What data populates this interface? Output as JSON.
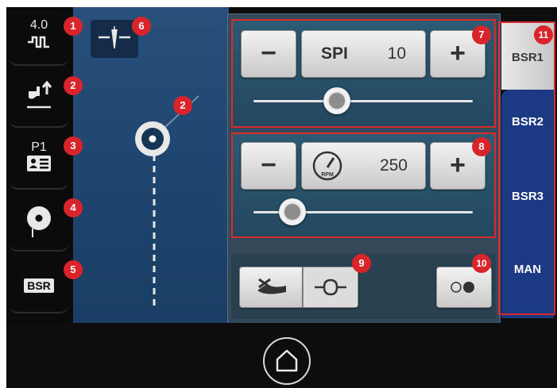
{
  "rail": {
    "r1": {
      "top": "4.0",
      "icon": "stitch-width-icon"
    },
    "r2": {
      "icon": "presser-foot-up-icon"
    },
    "r3": {
      "top": "P1",
      "icon": "program-icon"
    },
    "r4": {
      "icon": "bobbin-thread-icon"
    },
    "r5": {
      "label": "BSR"
    }
  },
  "controls": {
    "spi": {
      "minus": "−",
      "label": "SPI",
      "value": "10",
      "plus": "+",
      "slider_fraction": 0.38
    },
    "speed": {
      "minus": "−",
      "icon": "speedometer-icon",
      "icon_text": "RPM",
      "value": "250",
      "plus": "+",
      "slider_fraction": 0.17
    }
  },
  "tabs": {
    "t1": "BSR1",
    "t2": "BSR2",
    "t3": "BSR3",
    "t4": "MAN"
  },
  "badges": {
    "b1": "1",
    "b2": "2",
    "b3": "3",
    "b4": "4",
    "b5": "5",
    "b6": "6",
    "b2b": "2",
    "b7": "7",
    "b8": "8",
    "b9": "9",
    "b10": "10",
    "b11": "11"
  },
  "colors": {
    "accent_red": "#d92b2b",
    "canvas_blue": "#1f4670",
    "panel": "#33495a"
  }
}
